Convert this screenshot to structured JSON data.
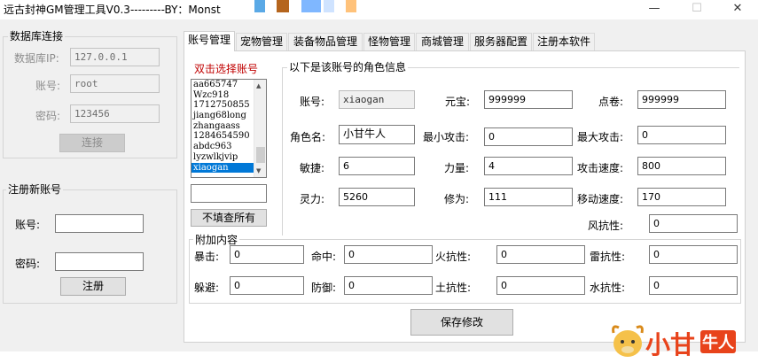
{
  "window": {
    "title": "远古封神GM管理工具V0.3---------BY：Monst",
    "minimize_glyph": "—",
    "maximize_glyph": "☐",
    "close_glyph": "✕"
  },
  "db": {
    "legend": "数据库连接",
    "ip_label": "数据库IP:",
    "ip_value": "127.0.0.1",
    "user_label": "账号:",
    "user_value": "root",
    "pass_label": "密码:",
    "pass_value": "123456",
    "connect_label": "连接"
  },
  "register": {
    "legend": "注册新账号",
    "account_label": "账号:",
    "account_value": "",
    "password_label": "密码:",
    "password_value": "",
    "register_label": "注册"
  },
  "tabs": [
    "账号管理",
    "宠物管理",
    "装备物品管理",
    "怪物管理",
    "商城管理",
    "服务器配置",
    "注册本软件"
  ],
  "accounts": {
    "heading": "双击选择账号",
    "items": [
      "aa665747",
      "Wzc918",
      "1712750855",
      "jiang68long",
      "zhangaass",
      "1284654590",
      "abdc963",
      "lyzwlkjvip",
      "xiaogan"
    ],
    "selected_index": 8,
    "filter_value": "",
    "show_all_label": "不填查所有",
    "scroll_up": "▲",
    "scroll_down": "▼"
  },
  "role": {
    "legend": "以下是该账号的角色信息",
    "account_label": "账号:",
    "account_value": "xiaogan",
    "gold_label": "元宝:",
    "gold_value": "999999",
    "points_label": "点卷:",
    "points_value": "999999",
    "name_label": "角色名:",
    "name_value": "小甘牛人",
    "min_attack_label": "最小攻击:",
    "min_attack_value": "0",
    "max_attack_label": "最大攻击:",
    "max_attack_value": "0",
    "agility_label": "敏捷:",
    "agility_value": "6",
    "strength_label": "力量:",
    "strength_value": "4",
    "attack_speed_label": "攻击速度:",
    "attack_speed_value": "800",
    "spirit_label": "灵力:",
    "spirit_value": "5260",
    "cultivation_label": "修为:",
    "cultivation_value": "111",
    "move_speed_label": "移动速度:",
    "move_speed_value": "170",
    "wind_res_label": "风抗性:",
    "wind_res_value": "0"
  },
  "extra": {
    "legend": "附加内容",
    "crit_label": "暴击:",
    "crit_value": "0",
    "hit_label": "命中:",
    "hit_value": "0",
    "fire_res_label": "火抗性:",
    "fire_res_value": "0",
    "thunder_res_label": "雷抗性:",
    "thunder_res_value": "0",
    "dodge_label": "躲避:",
    "dodge_value": "0",
    "defense_label": "防御:",
    "defense_value": "0",
    "earth_res_label": "土抗性:",
    "earth_res_value": "0",
    "water_res_label": "水抗性:",
    "water_res_value": "0"
  },
  "save_label": "保存修改",
  "watermark": {
    "text_main": "小甘",
    "text_badge": "牛人"
  },
  "colors": {
    "selection": "#0078d7",
    "heading_red": "#c00000",
    "watermark_orange": "#e8431b"
  }
}
